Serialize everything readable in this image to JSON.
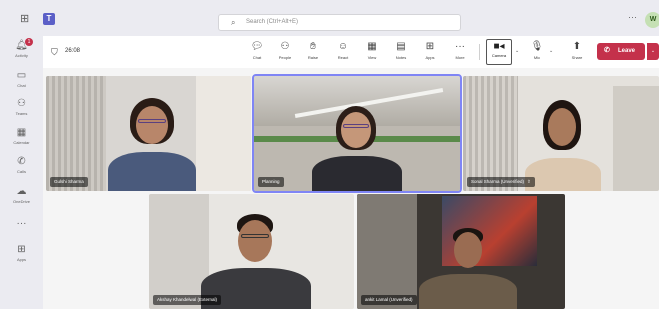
{
  "titlebar": {
    "search_placeholder": "Search (Ctrl+Alt+E)",
    "avatar_initials": "W"
  },
  "rail": {
    "items": [
      {
        "label": "Activity",
        "icon": "bell-icon",
        "badge": "1"
      },
      {
        "label": "Chat",
        "icon": "chat-icon"
      },
      {
        "label": "Teams",
        "icon": "teams-icon"
      },
      {
        "label": "Calendar",
        "icon": "calendar-icon"
      },
      {
        "label": "Calls",
        "icon": "phone-icon"
      },
      {
        "label": "OneDrive",
        "icon": "cloud-icon"
      },
      {
        "label": "",
        "icon": "more-icon"
      },
      {
        "label": "Apps",
        "icon": "apps-icon"
      }
    ]
  },
  "meeting": {
    "timer": "26:08",
    "tools": [
      {
        "label": "Chat",
        "icon": "chat-icon"
      },
      {
        "label": "People",
        "icon": "people-icon"
      },
      {
        "label": "Raise",
        "icon": "raise-hand-icon"
      },
      {
        "label": "React",
        "icon": "react-icon"
      },
      {
        "label": "View",
        "icon": "view-icon"
      },
      {
        "label": "Notes",
        "icon": "notes-icon"
      },
      {
        "label": "Apps",
        "icon": "apps-icon"
      },
      {
        "label": "More",
        "icon": "more-icon"
      }
    ],
    "camera_label": "Camera",
    "mic_label": "Mic",
    "share_label": "Share",
    "leave_label": "Leave",
    "accent": "#c4314b"
  },
  "participants": [
    {
      "name": "Gulshi Sharma"
    },
    {
      "name": "Planning"
    },
    {
      "name": "Sonal Sharma (Unverified)"
    },
    {
      "name": "Akshay Khandelwal (External)"
    },
    {
      "name": "ankit Lamal (Unverified)"
    }
  ]
}
